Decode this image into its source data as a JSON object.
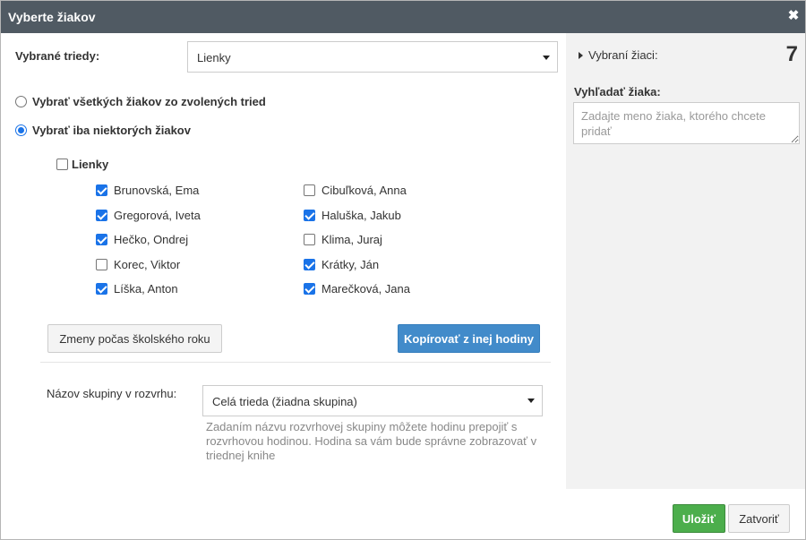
{
  "dialog": {
    "title": "Vyberte žiakov",
    "close_icon": "close-icon"
  },
  "classes": {
    "label": "Vybrané triedy:",
    "selected": "Lienky"
  },
  "options": {
    "all_label": "Vybrať všetkých žiakov zo zvolených tried",
    "some_label": "Vybrať iba niektorých žiakov",
    "selected": "some"
  },
  "group": {
    "name": "Lienky",
    "checked": false
  },
  "students": [
    {
      "name": "Brunovská, Ema",
      "checked": true
    },
    {
      "name": "Gregorová, Iveta",
      "checked": true
    },
    {
      "name": "Hečko, Ondrej",
      "checked": true
    },
    {
      "name": "Korec, Viktor",
      "checked": false
    },
    {
      "name": "Líška, Anton",
      "checked": true
    },
    {
      "name": "Cibuľková, Anna",
      "checked": false
    },
    {
      "name": "Haluška, Jakub",
      "checked": true
    },
    {
      "name": "Klima, Juraj",
      "checked": false
    },
    {
      "name": "Krátky, Ján",
      "checked": true
    },
    {
      "name": "Marečková, Jana",
      "checked": true
    }
  ],
  "buttons": {
    "changes": "Zmeny počas školského roku",
    "copy": "Kopírovať z inej hodiny",
    "save": "Uložiť",
    "close": "Zatvoriť"
  },
  "schedule": {
    "label": "Názov skupiny v rozvrhu:",
    "selected": "Celá trieda (žiadna skupina)",
    "help": "Zadaním názvu rozvrhovej skupiny môžete hodinu prepojiť s rozvrhovou hodinou. Hodina sa vám bude správne zobrazovať v triednej knihe"
  },
  "sidebar": {
    "selected_label": "Vybraní žiaci:",
    "selected_count": "7",
    "search_label": "Vyhľadať žiaka:",
    "search_placeholder": "Zadajte meno žiaka, ktorého chcete pridať"
  },
  "colors": {
    "titlebar": "#505a63",
    "primary": "#428bca",
    "success": "#4cae4c",
    "checkbox": "#1a73e8"
  }
}
